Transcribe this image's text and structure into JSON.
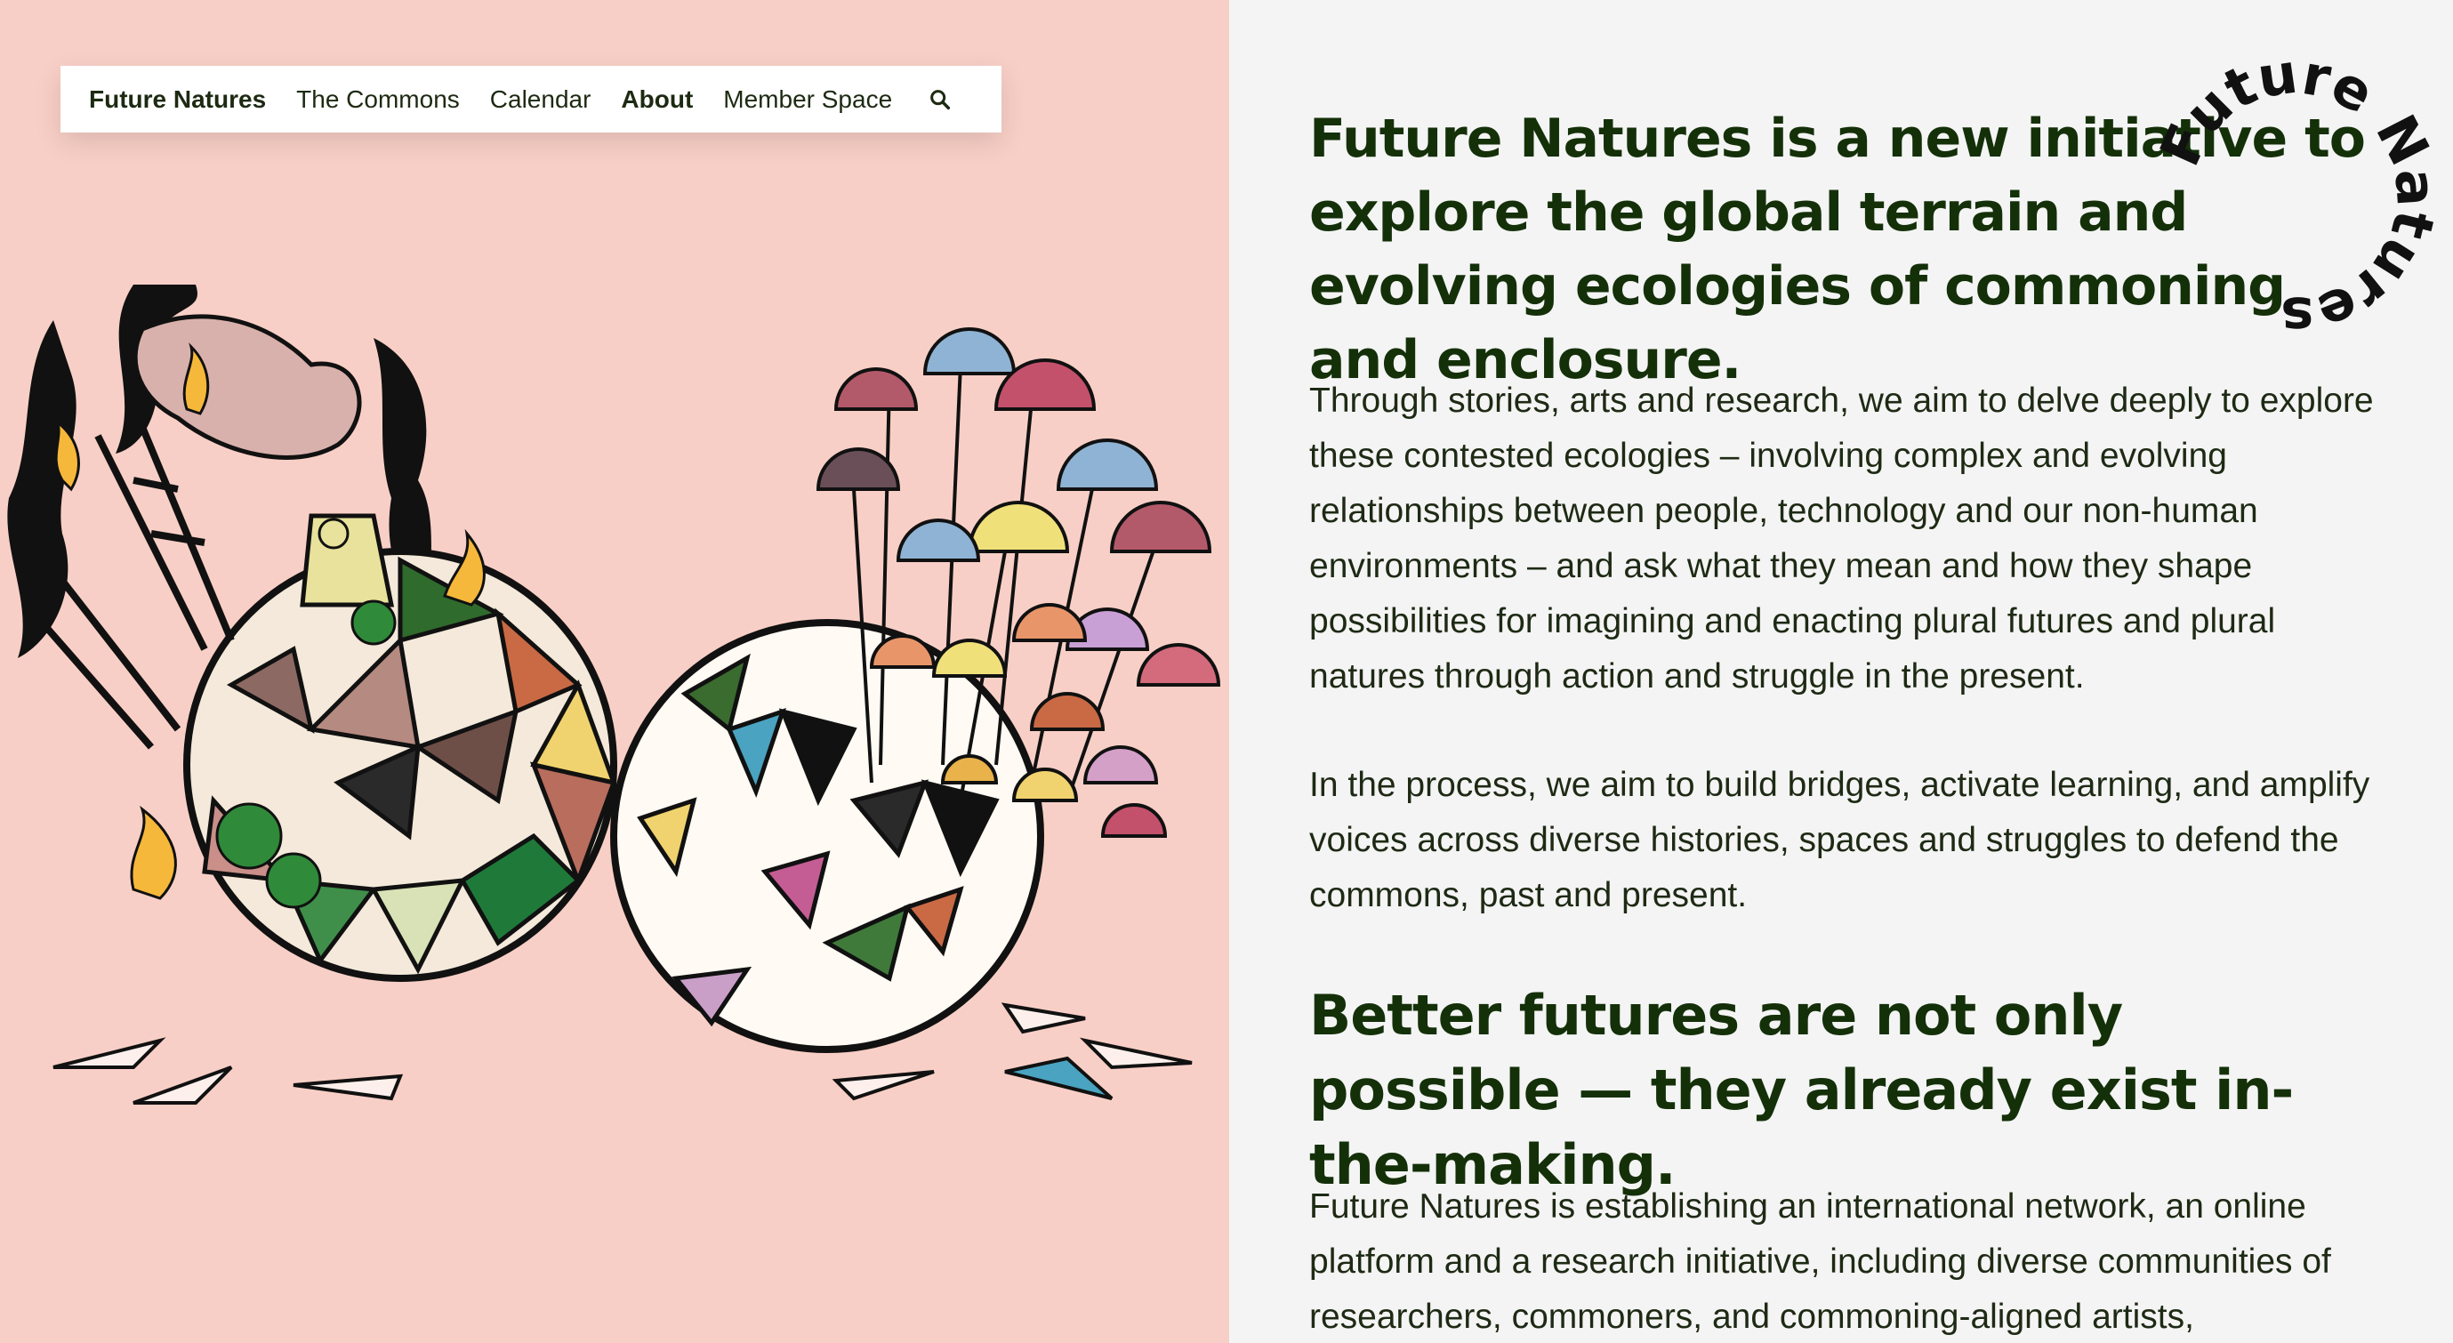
{
  "nav": {
    "items": [
      {
        "label": "Future Natures",
        "bold": true
      },
      {
        "label": "The Commons",
        "bold": false
      },
      {
        "label": "Calendar",
        "bold": false
      },
      {
        "label": "About",
        "bold": true
      },
      {
        "label": "Member Space",
        "bold": false
      }
    ],
    "search_icon": "search-icon"
  },
  "content": {
    "heading1": "Future Natures is a new initiative to explore the global terrain and evolving ecologies of commoning and enclosure.",
    "para1": "Through stories, arts and research, we aim to delve deeply to explore these contested ecologies – involving complex and evolving relationships between people, technology and our non-human environments – and ask what they mean and how they shape possibilities for imagining and enacting plural futures and plural natures through action and struggle in the present.",
    "para2": "In the process, we aim to build bridges, activate learning, and amplify voices across diverse histories, spaces and struggles to defend the commons, past and present.",
    "heading2": "Better futures are not only possible — they already exist in-the-making.",
    "para3": "Future Natures is establishing an international network, an online platform and a research initiative, including diverse communities of researchers, commoners, and commoning-aligned artists,"
  },
  "badge": {
    "text": "Future Natures"
  },
  "colors": {
    "left_bg": "#f8cfc6",
    "right_bg": "#f4f4f4",
    "heading": "#143009",
    "text": "#1e2a14"
  }
}
